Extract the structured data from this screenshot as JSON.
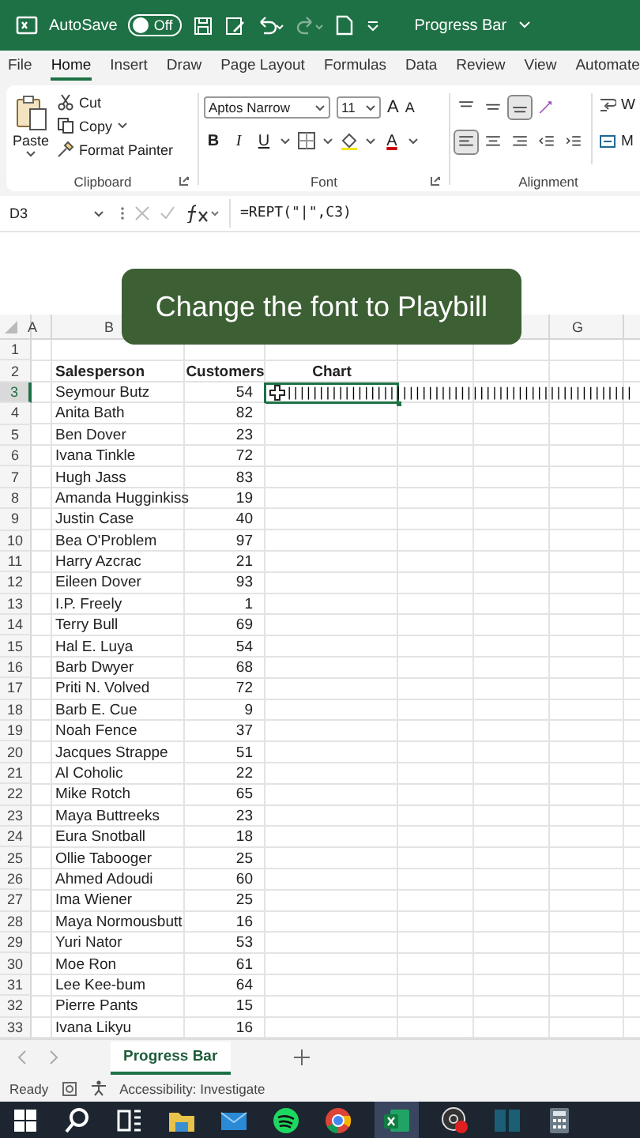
{
  "title_bar": {
    "autosave_label": "AutoSave",
    "autosave_on": false,
    "autosave_state": "Off",
    "document_title": "Progress Bar"
  },
  "ribbon_tabs": [
    {
      "label": "File",
      "selected": false
    },
    {
      "label": "Home",
      "selected": true
    },
    {
      "label": "Insert",
      "selected": false
    },
    {
      "label": "Draw",
      "selected": false
    },
    {
      "label": "Page Layout",
      "selected": false
    },
    {
      "label": "Formulas",
      "selected": false
    },
    {
      "label": "Data",
      "selected": false
    },
    {
      "label": "Review",
      "selected": false
    },
    {
      "label": "View",
      "selected": false
    },
    {
      "label": "Automate",
      "selected": false
    }
  ],
  "ribbon": {
    "clipboard": {
      "paste": "Paste",
      "cut": "Cut",
      "copy": "Copy",
      "format_painter": "Format Painter",
      "label": "Clipboard"
    },
    "font": {
      "font_name": "Aptos Narrow",
      "font_size": "11",
      "grow": "A",
      "shrink": "A",
      "bold": "B",
      "italic": "I",
      "underline": "U",
      "font_color": "A",
      "label": "Font"
    },
    "alignment": {
      "label": "Alignment",
      "wrap": "W",
      "merge": "M",
      "top_row": [
        {
          "kind": "top",
          "selected": false
        },
        {
          "kind": "middle",
          "selected": false
        },
        {
          "kind": "bottom",
          "selected": true
        },
        {
          "kind": "orient",
          "selected": false
        }
      ],
      "bottom_row": [
        {
          "kind": "left",
          "selected": true
        },
        {
          "kind": "center",
          "selected": false
        },
        {
          "kind": "right",
          "selected": false
        },
        {
          "kind": "outdent",
          "selected": false
        },
        {
          "kind": "indent",
          "selected": false
        }
      ]
    }
  },
  "formula_bar": {
    "name_box": "D3",
    "formula": "=REPT(\"|\",C3)"
  },
  "caption": "Change the font to Playbill",
  "columns": [
    {
      "letter": "A"
    },
    {
      "letter": "B"
    },
    {},
    {},
    {},
    {},
    {
      "letter": "G"
    },
    {}
  ],
  "rows": [
    {
      "number": "1",
      "selected": false
    },
    {
      "number": "2",
      "name": "Salesperson",
      "customers": "Customers",
      "chart": "Chart",
      "header": true,
      "selected": false
    },
    {
      "number": "3",
      "name": "Seymour Butz",
      "customers": "54",
      "chart": "||||||||||||||||||||||||||||||||||||||||||||||||||||||",
      "selected": true
    },
    {
      "number": "4",
      "name": "Anita Bath",
      "customers": "82",
      "selected": false
    },
    {
      "number": "5",
      "name": "Ben Dover",
      "customers": "23",
      "selected": false
    },
    {
      "number": "6",
      "name": "Ivana Tinkle",
      "customers": "72",
      "selected": false
    },
    {
      "number": "7",
      "name": "Hugh Jass",
      "customers": "83",
      "selected": false
    },
    {
      "number": "8",
      "name": "Amanda Hugginkiss",
      "customers": "19",
      "selected": false
    },
    {
      "number": "9",
      "name": "Justin Case",
      "customers": "40",
      "selected": false
    },
    {
      "number": "10",
      "name": "Bea O'Problem",
      "customers": "97",
      "selected": false
    },
    {
      "number": "11",
      "name": "Harry Azcrac",
      "customers": "21",
      "selected": false
    },
    {
      "number": "12",
      "name": "Eileen Dover",
      "customers": "93",
      "selected": false
    },
    {
      "number": "13",
      "name": "I.P. Freely",
      "customers": "1",
      "selected": false
    },
    {
      "number": "14",
      "name": "Terry Bull",
      "customers": "69",
      "selected": false
    },
    {
      "number": "15",
      "name": "Hal E. Luya",
      "customers": "54",
      "selected": false
    },
    {
      "number": "16",
      "name": "Barb Dwyer",
      "customers": "68",
      "selected": false
    },
    {
      "number": "17",
      "name": "Priti N. Volved",
      "customers": "72",
      "selected": false
    },
    {
      "number": "18",
      "name": "Barb E. Cue",
      "customers": "9",
      "selected": false
    },
    {
      "number": "19",
      "name": "Noah Fence",
      "customers": "37",
      "selected": false
    },
    {
      "number": "20",
      "name": "Jacques Strappe",
      "customers": "51",
      "selected": false
    },
    {
      "number": "21",
      "name": "Al Coholic",
      "customers": "22",
      "selected": false
    },
    {
      "number": "22",
      "name": "Mike Rotch",
      "customers": "65",
      "selected": false
    },
    {
      "number": "23",
      "name": "Maya Buttreeks",
      "customers": "23",
      "selected": false
    },
    {
      "number": "24",
      "name": "Eura Snotball",
      "customers": "18",
      "selected": false
    },
    {
      "number": "25",
      "name": "Ollie Tabooger",
      "customers": "25",
      "selected": false
    },
    {
      "number": "26",
      "name": "Ahmed Adoudi",
      "customers": "60",
      "selected": false
    },
    {
      "number": "27",
      "name": "Ima Wiener",
      "customers": "25",
      "selected": false
    },
    {
      "number": "28",
      "name": "Maya Normousbutt",
      "customers": "16",
      "selected": false
    },
    {
      "number": "29",
      "name": "Yuri Nator",
      "customers": "53",
      "selected": false
    },
    {
      "number": "30",
      "name": "Moe Ron",
      "customers": "61",
      "selected": false
    },
    {
      "number": "31",
      "name": "Lee Kee-bum",
      "customers": "64",
      "selected": false
    },
    {
      "number": "32",
      "name": "Pierre Pants",
      "customers": "15",
      "selected": false
    },
    {
      "number": "33",
      "name": "Ivana Likyu",
      "customers": "16",
      "selected": false
    }
  ],
  "sheet_tabs": [
    {
      "label": "Progress Bar",
      "selected": true
    }
  ],
  "status_bar": {
    "ready": "Ready",
    "accessibility": "Accessibility: Investigate"
  },
  "taskbar": [
    {
      "kind": "windows",
      "active": false
    },
    {
      "kind": "search",
      "active": false
    },
    {
      "kind": "taskview",
      "active": false
    },
    {
      "kind": "folder",
      "active": false
    },
    {
      "kind": "mail",
      "active": false
    },
    {
      "kind": "music",
      "active": false
    },
    {
      "kind": "browser",
      "active": false
    },
    {
      "kind": "excel",
      "active": true
    },
    {
      "kind": "recorder",
      "active": false
    },
    {
      "kind": "panel",
      "active": false
    },
    {
      "kind": "calculator",
      "active": false
    }
  ]
}
